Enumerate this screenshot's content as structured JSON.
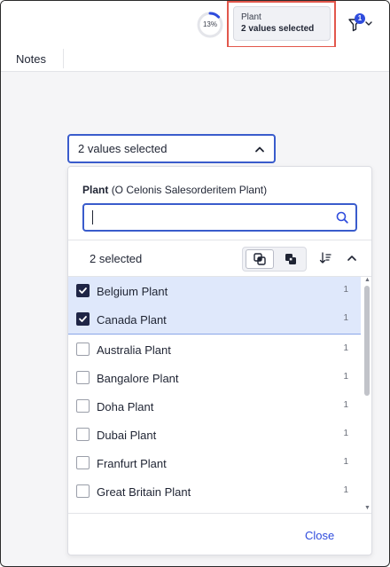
{
  "header": {
    "progress_percent_label": "13%",
    "progress_value": 0.13,
    "filter_chip": {
      "title": "Plant",
      "value": "2 values selected"
    },
    "filter_badge_count": "1"
  },
  "tabs": {
    "notes_label": "Notes"
  },
  "dropdown": {
    "trigger_text": "2 values selected",
    "panel_title_bold": "Plant",
    "panel_title_rest": "(O Celonis Salesorderitem Plant)",
    "search": {
      "value": "",
      "placeholder": ""
    },
    "selected_count_label": "2 selected",
    "items": [
      {
        "label": "Belgium Plant",
        "count": "1",
        "checked": true
      },
      {
        "label": "Canada Plant",
        "count": "1",
        "checked": true
      },
      {
        "label": "Australia Plant",
        "count": "1",
        "checked": false
      },
      {
        "label": "Bangalore Plant",
        "count": "1",
        "checked": false
      },
      {
        "label": "Doha Plant",
        "count": "1",
        "checked": false
      },
      {
        "label": "Dubai Plant",
        "count": "1",
        "checked": false
      },
      {
        "label": "Franfurt Plant",
        "count": "1",
        "checked": false
      },
      {
        "label": "Great Britain Plant",
        "count": "1",
        "checked": false
      }
    ],
    "close_label": "Close"
  },
  "colors": {
    "accent": "#2f4cdd",
    "focus_border": "#3a5ccc",
    "selected_row": "#dfe8fb",
    "highlight_box": "#e2574c",
    "checkbox_checked": "#1f2546"
  },
  "icons": {
    "search": "search-icon",
    "filter": "filter-icon",
    "chevron_up": "chevron-up-icon",
    "sort": "sort-icon",
    "check": "check-icon"
  }
}
